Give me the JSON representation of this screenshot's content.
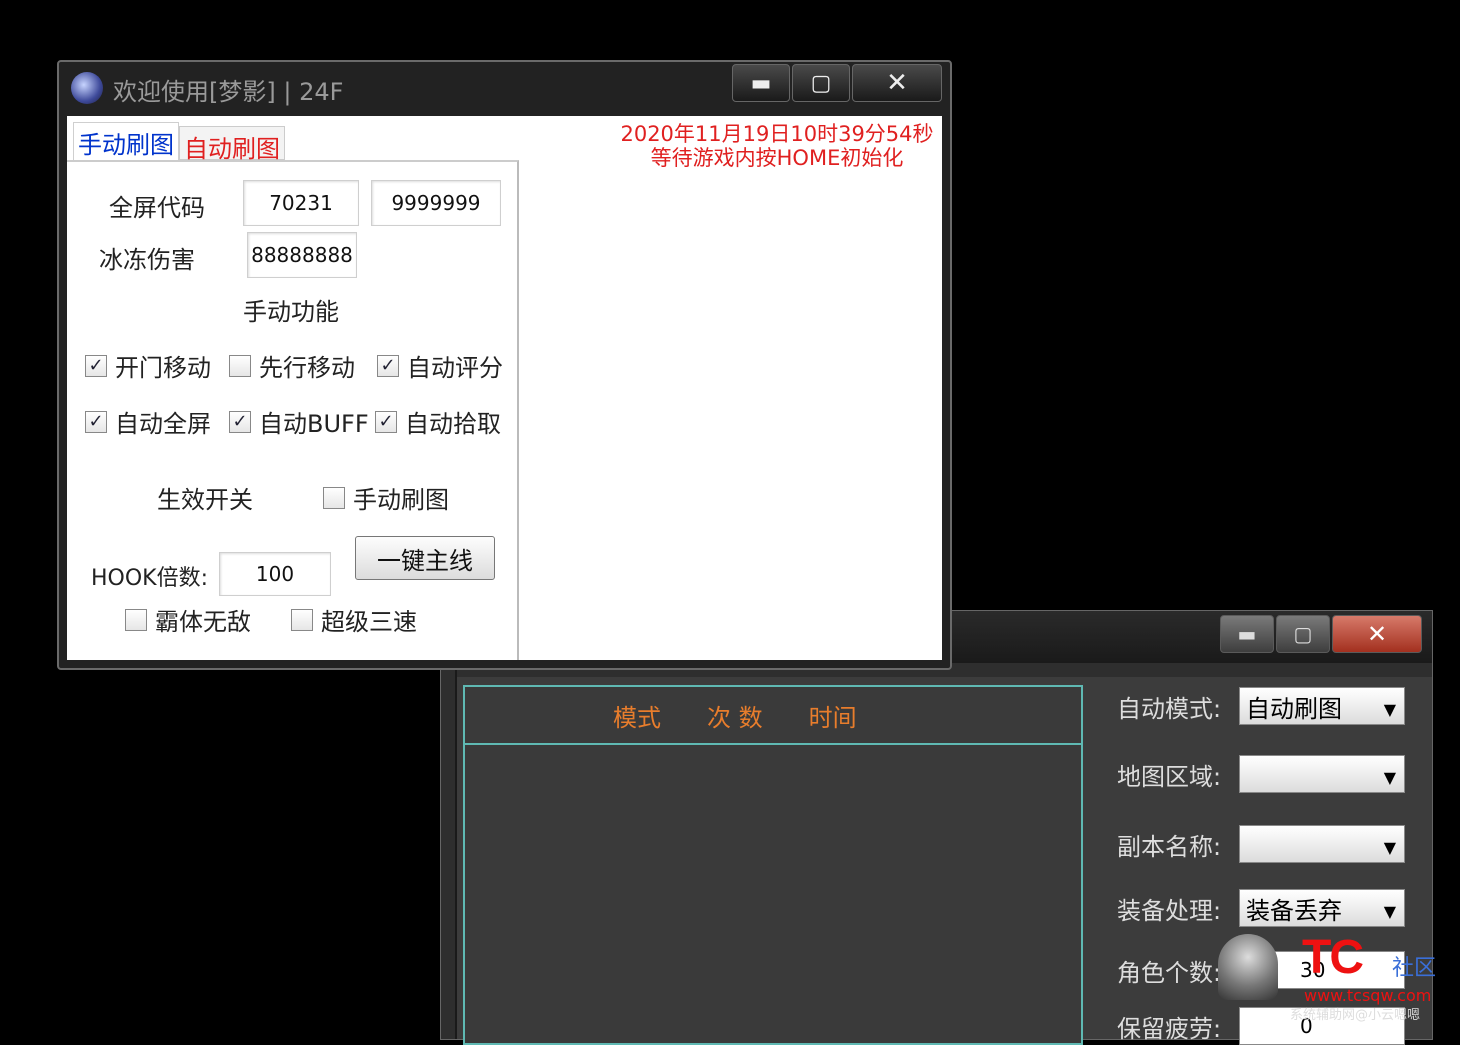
{
  "window1": {
    "title": "欢迎使用[梦影] | 24F",
    "caption": {
      "min": "▬",
      "max": "▢",
      "close": "✕"
    },
    "tabs": [
      {
        "label": "手动刷图",
        "active": true
      },
      {
        "label": "自动刷图",
        "active": false
      }
    ],
    "status": {
      "line1": "2020年11月19日10时39分54秒",
      "line2": "等待游戏内按HOME初始化",
      "color": "#e02020"
    },
    "manual": {
      "fullscreen_code_label": "全屏代码",
      "fullscreen_code_value1": "70231",
      "fullscreen_code_value2": "9999999",
      "freeze_damage_label": "冰冻伤害",
      "freeze_damage_value": "88888888",
      "section_title": "手动功能",
      "checkboxes": [
        {
          "label": "开门移动",
          "checked": true
        },
        {
          "label": "先行移动",
          "checked": false
        },
        {
          "label": "自动评分",
          "checked": true
        },
        {
          "label": "自动全屏",
          "checked": true
        },
        {
          "label": "自动BUFF",
          "checked": true
        },
        {
          "label": "自动拾取",
          "checked": true
        }
      ],
      "effect_switch_label": "生效开关",
      "manual_brush": {
        "label": "手动刷图",
        "checked": false
      },
      "hook_label": "HOOK倍数:",
      "hook_value": "100",
      "main_quest_button": "一键主线",
      "invincible": {
        "label": "霸体无敌",
        "checked": false
      },
      "triple_speed": {
        "label": "超级三速",
        "checked": false
      }
    }
  },
  "window2": {
    "caption": {
      "min": "▬",
      "max": "▢",
      "close": "✕"
    },
    "list_columns": [
      "模式",
      "次 数",
      "时间"
    ],
    "column_color": "#e87d2c",
    "form": [
      {
        "label": "自动模式:",
        "value": "自动刷图"
      },
      {
        "label": "地图区域:",
        "value": ""
      },
      {
        "label": "副本名称:",
        "value": ""
      },
      {
        "label": "装备处理:",
        "value": "装备丢弃"
      },
      {
        "label": "角色个数:",
        "value": "30"
      },
      {
        "label": "保留疲劳:",
        "value": "0"
      }
    ]
  },
  "watermark": {
    "logo": "TC",
    "tag": "社区",
    "url": "www.tcsqw.com",
    "credit": "系统辅助网@小云嗯嗯"
  }
}
